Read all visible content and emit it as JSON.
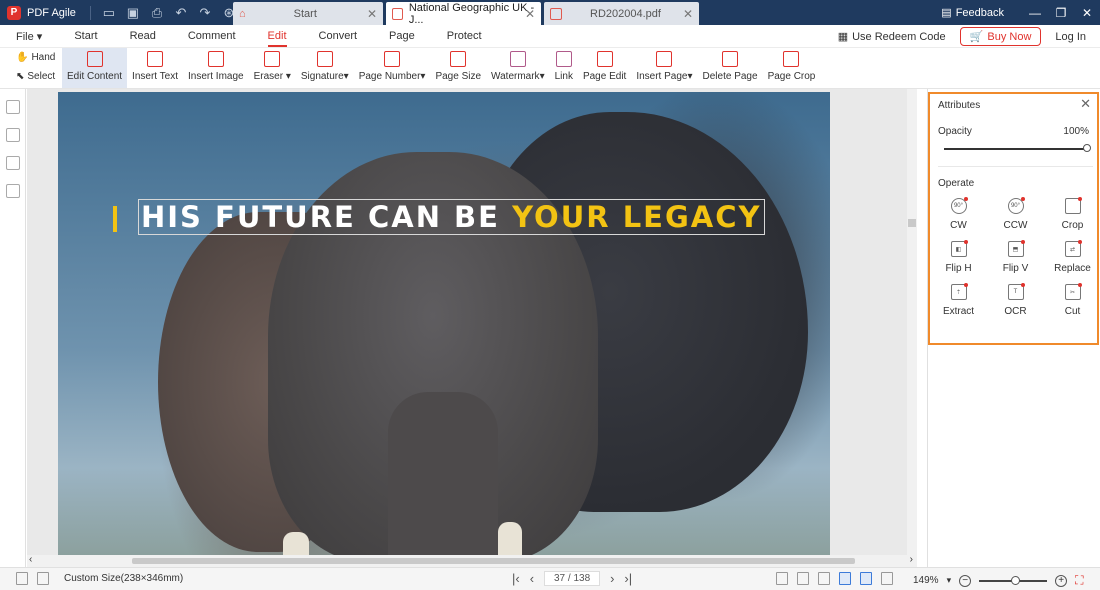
{
  "app": {
    "name": "PDF Agile"
  },
  "tabs": [
    {
      "label": "Start"
    },
    {
      "label": "National Geographic UK - J..."
    },
    {
      "label": "RD202004.pdf"
    }
  ],
  "titlebar": {
    "feedback": "Feedback"
  },
  "menu": {
    "items": [
      "File",
      "Start",
      "Read",
      "Comment",
      "Edit",
      "Convert",
      "Page",
      "Protect"
    ],
    "redeem": "Use Redeem Code",
    "buy_now": "Buy Now",
    "login": "Log In"
  },
  "toolbar": {
    "hand": "Hand",
    "select": "Select",
    "tools": [
      "Edit Content",
      "Insert Text",
      "Insert Image",
      "Eraser",
      "Signature",
      "Page Number",
      "Page Size",
      "Watermark",
      "Link",
      "Page Edit",
      "Insert Page",
      "Delete Page",
      "Page Crop"
    ]
  },
  "document": {
    "headline_white": "HIS FUTURE CAN BE",
    "headline_yellow": "YOUR LEGACY"
  },
  "attributes": {
    "title": "Attributes",
    "opacity_label": "Opacity",
    "opacity_value": "100%",
    "opacity_fraction": 1.0,
    "operate_label": "Operate",
    "ops": [
      "CW",
      "CCW",
      "Crop",
      "Flip H",
      "Flip V",
      "Replace",
      "Extract",
      "OCR",
      "Cut"
    ]
  },
  "status": {
    "page_size": "Custom Size(238×346mm)",
    "page_indicator": "37 / 138",
    "zoom": "149%"
  },
  "colors": {
    "brand_red": "#e0332d",
    "titlebar_bg": "#1f3a5f",
    "highlight_orange": "#f08a2b",
    "headline_yellow": "#f3c313"
  }
}
